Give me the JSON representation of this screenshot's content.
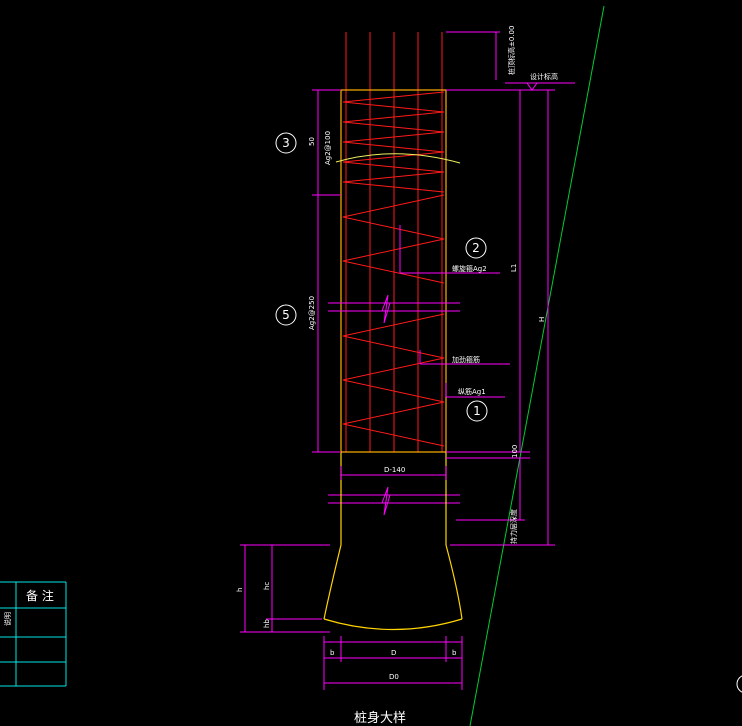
{
  "colors": {
    "background": "#000000",
    "rebar": "#ff1a1a",
    "outline": "#ffd400",
    "dimension": "#ff00ff",
    "text": "#ffffff",
    "slope_line": "#00cc33",
    "table_border": "#00e5e5",
    "curve": "#f0f060"
  },
  "title": "桩身大样",
  "callouts": {
    "c1": "1",
    "c2": "2",
    "c3": "3",
    "c5": "5"
  },
  "labels": {
    "top_elev": "桩顶标高±0.00",
    "design_elev": "设计标高",
    "spiral_bar": "螺旋箍Ag2",
    "stiffener_ring": "加劲箍筋",
    "main_bar": "纵筋Ag1",
    "spacing_top": "Ag2@100",
    "spacing_mid": "Ag2@250",
    "dim_50": "50",
    "diameter": "D-140",
    "L1": "L1",
    "H": "H",
    "dim_100": "100",
    "bearing_layer": "持力层深度",
    "h": "h",
    "hc": "hc",
    "hb": "hb",
    "b_left": "b",
    "D": "D",
    "b_right": "b",
    "D0": "D0"
  },
  "table": {
    "header": "备 注",
    "side_label": "说明"
  }
}
